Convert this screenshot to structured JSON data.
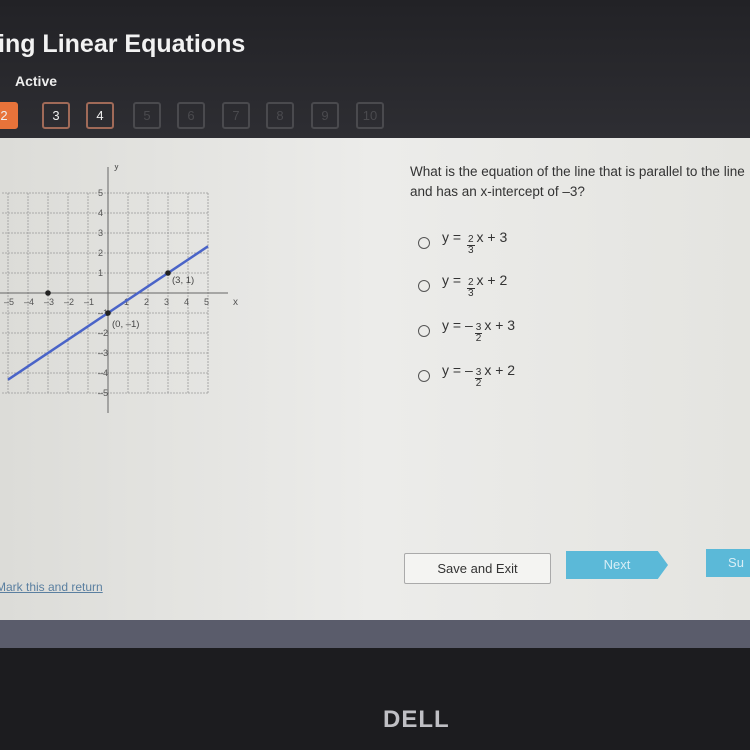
{
  "header": {
    "title": "ing Linear Equations",
    "status": "Active",
    "questions": [
      {
        "label": "2",
        "state": "current"
      },
      {
        "label": "3",
        "state": "visited"
      },
      {
        "label": "4",
        "state": "visited"
      },
      {
        "label": "5",
        "state": "disabled"
      },
      {
        "label": "6",
        "state": "disabled"
      },
      {
        "label": "7",
        "state": "disabled"
      },
      {
        "label": "8",
        "state": "disabled"
      },
      {
        "label": "9",
        "state": "disabled"
      },
      {
        "label": "10",
        "state": "disabled"
      }
    ]
  },
  "question": {
    "text": "What is the equation of the line that is parallel to the line and has an x-intercept of –3?",
    "options": [
      {
        "pre": "y = ",
        "sign": "",
        "num": "2",
        "den": "3",
        "post": "x + 3"
      },
      {
        "pre": "y = ",
        "sign": "",
        "num": "2",
        "den": "3",
        "post": "x + 2"
      },
      {
        "pre": "y = ",
        "sign": "–",
        "num": "3",
        "den": "2",
        "post": "x + 3"
      },
      {
        "pre": "y = ",
        "sign": "–",
        "num": "3",
        "den": "2",
        "post": "x + 2"
      }
    ]
  },
  "chart_data": {
    "type": "line",
    "xlabel": "x",
    "ylabel": "y",
    "xlim": [
      -5,
      5
    ],
    "ylim": [
      -5,
      5
    ],
    "grid": true,
    "xticks": [
      "–5",
      "–4",
      "–3",
      "–2",
      "–1",
      "1",
      "2",
      "3",
      "4",
      "5"
    ],
    "yticks": [
      "5",
      "4",
      "3",
      "2",
      "1",
      "–1",
      "–2",
      "–3",
      "–4",
      "–5"
    ],
    "line": {
      "slope": 0.6667,
      "intercept": -1,
      "color": "#4a64c8"
    },
    "points": [
      {
        "x": 0,
        "y": -1,
        "label": "(0, –1)"
      },
      {
        "x": 3,
        "y": 1,
        "label": "(3, 1)"
      },
      {
        "x": -3,
        "y": 0,
        "label": ""
      }
    ]
  },
  "footer": {
    "save": "Save and Exit",
    "next": "Next",
    "submit": "Su",
    "mark": "Mark this and return"
  },
  "bezel": {
    "logo": "DELL"
  }
}
